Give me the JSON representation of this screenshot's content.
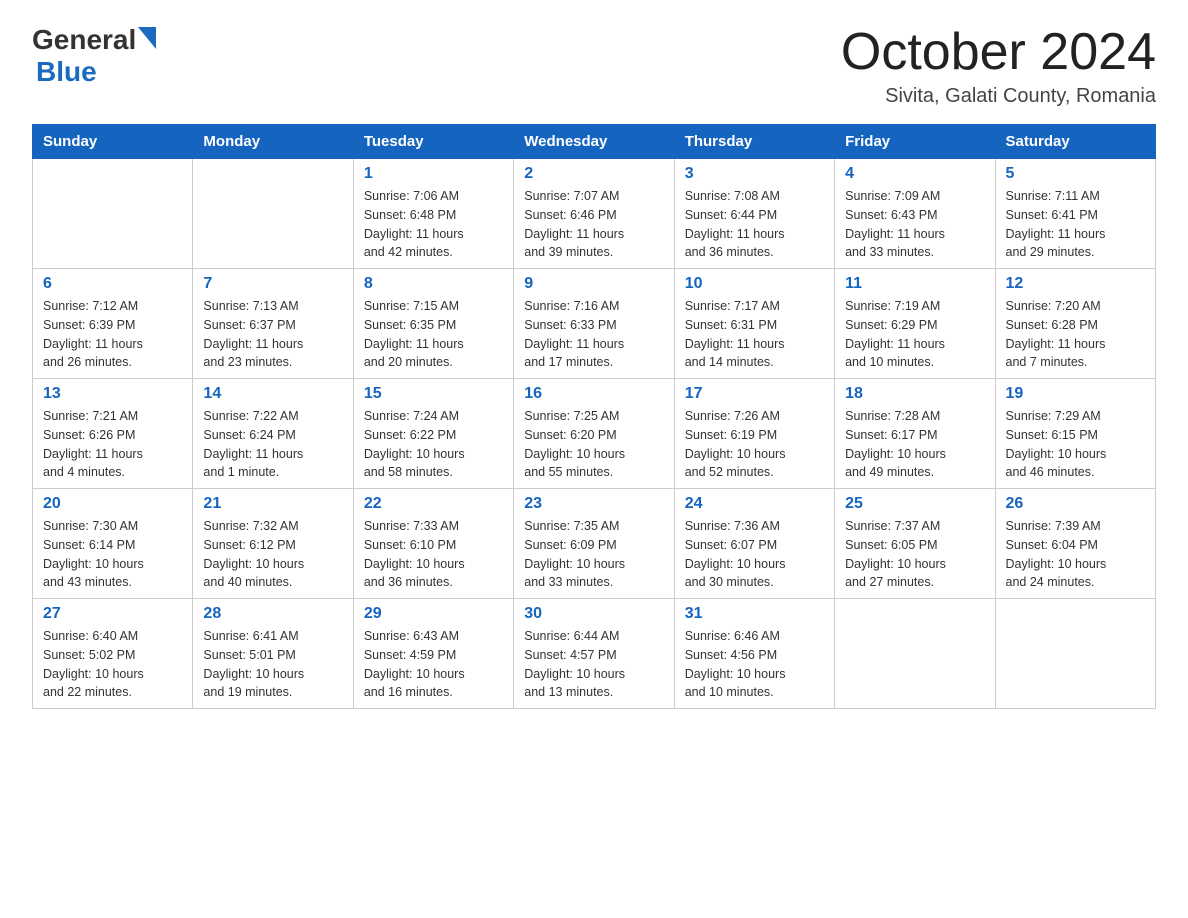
{
  "header": {
    "logo_general": "General",
    "logo_blue": "Blue",
    "month_title": "October 2024",
    "location": "Sivita, Galati County, Romania"
  },
  "weekdays": [
    "Sunday",
    "Monday",
    "Tuesday",
    "Wednesday",
    "Thursday",
    "Friday",
    "Saturday"
  ],
  "weeks": [
    [
      {
        "day": "",
        "info": ""
      },
      {
        "day": "",
        "info": ""
      },
      {
        "day": "1",
        "info": "Sunrise: 7:06 AM\nSunset: 6:48 PM\nDaylight: 11 hours\nand 42 minutes."
      },
      {
        "day": "2",
        "info": "Sunrise: 7:07 AM\nSunset: 6:46 PM\nDaylight: 11 hours\nand 39 minutes."
      },
      {
        "day": "3",
        "info": "Sunrise: 7:08 AM\nSunset: 6:44 PM\nDaylight: 11 hours\nand 36 minutes."
      },
      {
        "day": "4",
        "info": "Sunrise: 7:09 AM\nSunset: 6:43 PM\nDaylight: 11 hours\nand 33 minutes."
      },
      {
        "day": "5",
        "info": "Sunrise: 7:11 AM\nSunset: 6:41 PM\nDaylight: 11 hours\nand 29 minutes."
      }
    ],
    [
      {
        "day": "6",
        "info": "Sunrise: 7:12 AM\nSunset: 6:39 PM\nDaylight: 11 hours\nand 26 minutes."
      },
      {
        "day": "7",
        "info": "Sunrise: 7:13 AM\nSunset: 6:37 PM\nDaylight: 11 hours\nand 23 minutes."
      },
      {
        "day": "8",
        "info": "Sunrise: 7:15 AM\nSunset: 6:35 PM\nDaylight: 11 hours\nand 20 minutes."
      },
      {
        "day": "9",
        "info": "Sunrise: 7:16 AM\nSunset: 6:33 PM\nDaylight: 11 hours\nand 17 minutes."
      },
      {
        "day": "10",
        "info": "Sunrise: 7:17 AM\nSunset: 6:31 PM\nDaylight: 11 hours\nand 14 minutes."
      },
      {
        "day": "11",
        "info": "Sunrise: 7:19 AM\nSunset: 6:29 PM\nDaylight: 11 hours\nand 10 minutes."
      },
      {
        "day": "12",
        "info": "Sunrise: 7:20 AM\nSunset: 6:28 PM\nDaylight: 11 hours\nand 7 minutes."
      }
    ],
    [
      {
        "day": "13",
        "info": "Sunrise: 7:21 AM\nSunset: 6:26 PM\nDaylight: 11 hours\nand 4 minutes."
      },
      {
        "day": "14",
        "info": "Sunrise: 7:22 AM\nSunset: 6:24 PM\nDaylight: 11 hours\nand 1 minute."
      },
      {
        "day": "15",
        "info": "Sunrise: 7:24 AM\nSunset: 6:22 PM\nDaylight: 10 hours\nand 58 minutes."
      },
      {
        "day": "16",
        "info": "Sunrise: 7:25 AM\nSunset: 6:20 PM\nDaylight: 10 hours\nand 55 minutes."
      },
      {
        "day": "17",
        "info": "Sunrise: 7:26 AM\nSunset: 6:19 PM\nDaylight: 10 hours\nand 52 minutes."
      },
      {
        "day": "18",
        "info": "Sunrise: 7:28 AM\nSunset: 6:17 PM\nDaylight: 10 hours\nand 49 minutes."
      },
      {
        "day": "19",
        "info": "Sunrise: 7:29 AM\nSunset: 6:15 PM\nDaylight: 10 hours\nand 46 minutes."
      }
    ],
    [
      {
        "day": "20",
        "info": "Sunrise: 7:30 AM\nSunset: 6:14 PM\nDaylight: 10 hours\nand 43 minutes."
      },
      {
        "day": "21",
        "info": "Sunrise: 7:32 AM\nSunset: 6:12 PM\nDaylight: 10 hours\nand 40 minutes."
      },
      {
        "day": "22",
        "info": "Sunrise: 7:33 AM\nSunset: 6:10 PM\nDaylight: 10 hours\nand 36 minutes."
      },
      {
        "day": "23",
        "info": "Sunrise: 7:35 AM\nSunset: 6:09 PM\nDaylight: 10 hours\nand 33 minutes."
      },
      {
        "day": "24",
        "info": "Sunrise: 7:36 AM\nSunset: 6:07 PM\nDaylight: 10 hours\nand 30 minutes."
      },
      {
        "day": "25",
        "info": "Sunrise: 7:37 AM\nSunset: 6:05 PM\nDaylight: 10 hours\nand 27 minutes."
      },
      {
        "day": "26",
        "info": "Sunrise: 7:39 AM\nSunset: 6:04 PM\nDaylight: 10 hours\nand 24 minutes."
      }
    ],
    [
      {
        "day": "27",
        "info": "Sunrise: 6:40 AM\nSunset: 5:02 PM\nDaylight: 10 hours\nand 22 minutes."
      },
      {
        "day": "28",
        "info": "Sunrise: 6:41 AM\nSunset: 5:01 PM\nDaylight: 10 hours\nand 19 minutes."
      },
      {
        "day": "29",
        "info": "Sunrise: 6:43 AM\nSunset: 4:59 PM\nDaylight: 10 hours\nand 16 minutes."
      },
      {
        "day": "30",
        "info": "Sunrise: 6:44 AM\nSunset: 4:57 PM\nDaylight: 10 hours\nand 13 minutes."
      },
      {
        "day": "31",
        "info": "Sunrise: 6:46 AM\nSunset: 4:56 PM\nDaylight: 10 hours\nand 10 minutes."
      },
      {
        "day": "",
        "info": ""
      },
      {
        "day": "",
        "info": ""
      }
    ]
  ]
}
